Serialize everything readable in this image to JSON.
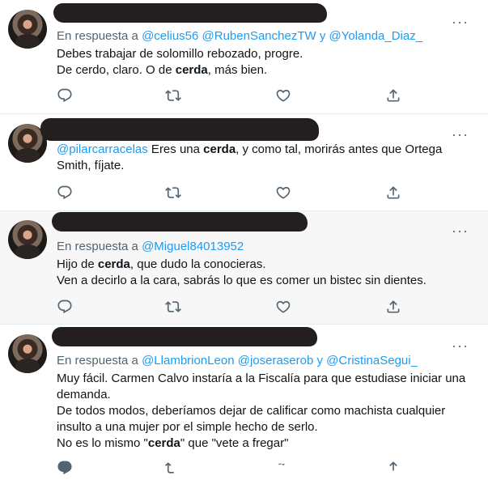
{
  "tweets": [
    {
      "reply_prefix": "En respuesta a",
      "mentions": [
        "@celius56",
        "@RubenSanchezTW"
      ],
      "joiner": "y",
      "last_mention": "@Yolanda_Diaz_",
      "lines": [
        {
          "a": "Debes trabajar de solomillo rebozado, progre.",
          "b": "",
          "c": ""
        },
        {
          "a": "De cerdo, claro. O de ",
          "b": "cerda",
          "c": ", más bien."
        }
      ]
    },
    {
      "mention": "@pilarcarracelas",
      "lines": [
        {
          "a": " Eres una ",
          "b": "cerda",
          "c": ", y como tal, morirás antes que Ortega"
        },
        {
          "a": "Smith, fíjate.",
          "b": "",
          "c": ""
        }
      ]
    },
    {
      "reply_prefix": "En respuesta a",
      "last_mention": "@Miguel84013952",
      "lines": [
        {
          "a": "Hijo de ",
          "b": "cerda",
          "c": ", que dudo la conocieras."
        },
        {
          "a": "Ven a decirlo a la cara, sabrás lo que es comer un bistec sin dientes.",
          "b": "",
          "c": ""
        }
      ]
    },
    {
      "reply_prefix": "En respuesta a",
      "mentions": [
        "@LlambrionLeon",
        "@joseraserob"
      ],
      "joiner": "y",
      "last_mention": "@CristinaSegui_",
      "lines": [
        {
          "a": "Muy fácil. Carmen Calvo instaría a la Fiscalía para que estudiase iniciar una",
          "b": "",
          "c": ""
        },
        {
          "a": "demanda.",
          "b": "",
          "c": ""
        },
        {
          "a": "De todos modos, deberíamos dejar de calificar como machista cualquier",
          "b": "",
          "c": ""
        },
        {
          "a": "insulto a una mujer por el simple hecho de serlo.",
          "b": "",
          "c": ""
        },
        {
          "a": "No es lo mismo \"",
          "b": "cerda",
          "c": "\" que \"vete a fregar\""
        }
      ]
    }
  ],
  "icons": {
    "reply": "reply-icon",
    "retweet": "retweet-icon",
    "like": "heart-icon",
    "share": "share-icon",
    "more": "more-options-icon"
  },
  "colors": {
    "link": "#1d9bf0",
    "muted": "#536471",
    "text": "#0f1419",
    "highlight_bg": "#f7f7f7"
  }
}
